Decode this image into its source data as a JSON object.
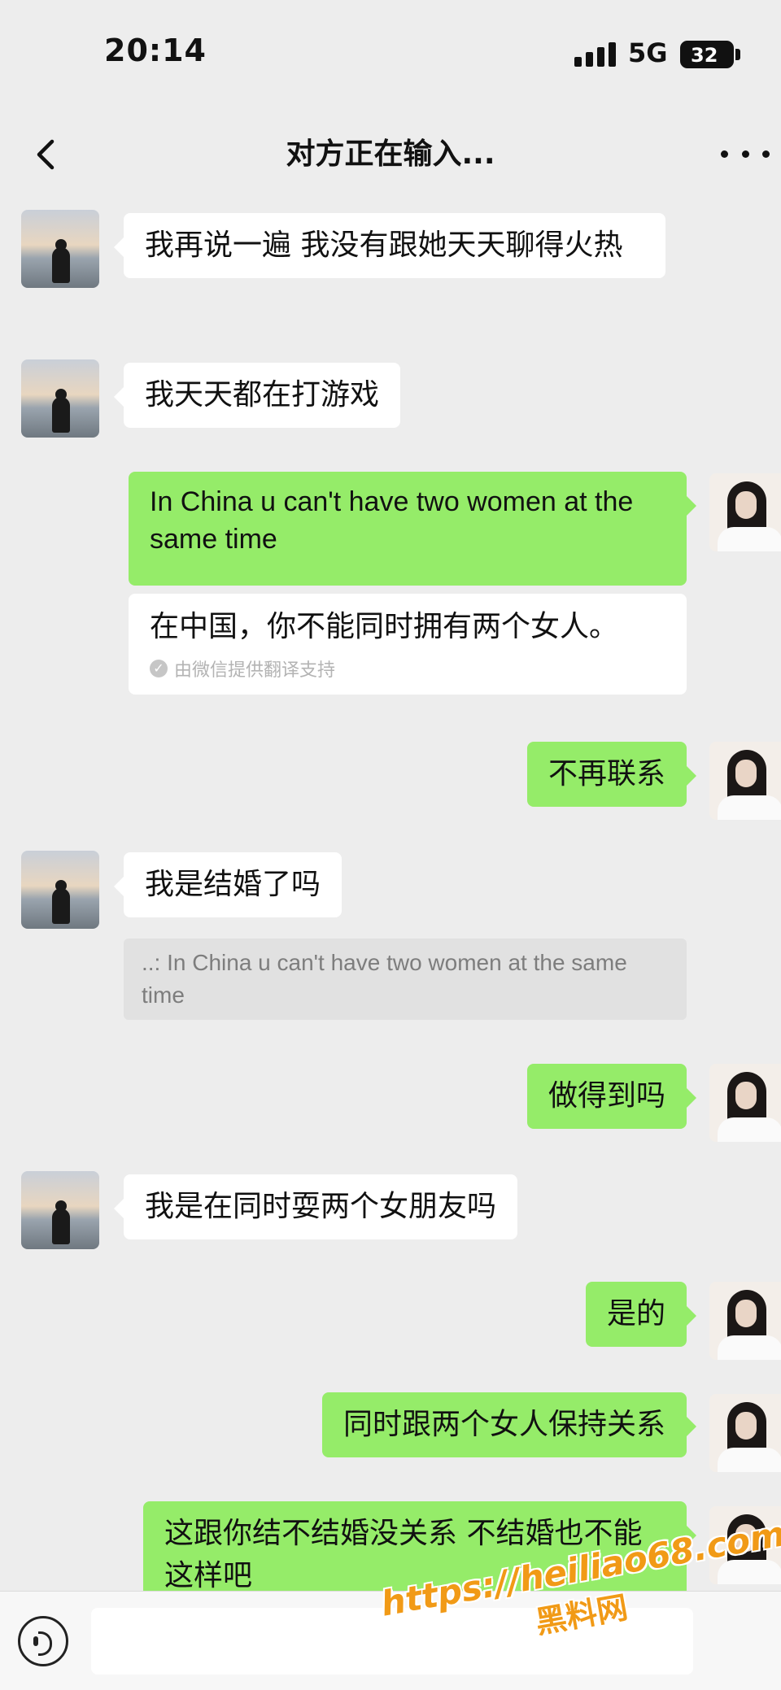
{
  "status_bar": {
    "time": "20:14",
    "network": "5G",
    "battery": "32"
  },
  "header": {
    "title": "对方正在输入..."
  },
  "messages": [
    {
      "side": "left",
      "avatar": "sunset-silhouette-avatar",
      "text": "我再说一遍 我没有跟她天天聊得火热"
    },
    {
      "side": "left",
      "avatar": "sunset-silhouette-avatar",
      "text": "我天天都在打游戏"
    },
    {
      "side": "right",
      "avatar": "woman-avatar",
      "text": "In China u can't have two women at the same time",
      "translation": {
        "text": "在中国，你不能同时拥有两个女人。",
        "note": "由微信提供翻译支持"
      }
    },
    {
      "side": "right",
      "avatar": "woman-avatar",
      "text": "不再联系"
    },
    {
      "side": "left",
      "avatar": "sunset-silhouette-avatar",
      "text": "我是结婚了吗",
      "quote": "..: In China u can't have two women at the same time"
    },
    {
      "side": "right",
      "avatar": "woman-avatar",
      "text": "做得到吗"
    },
    {
      "side": "left",
      "avatar": "sunset-silhouette-avatar",
      "text": "我是在同时耍两个女朋友吗"
    },
    {
      "side": "right",
      "avatar": "woman-avatar",
      "text": "是的"
    },
    {
      "side": "right",
      "avatar": "woman-avatar",
      "text": "同时跟两个女人保持关系"
    },
    {
      "side": "right",
      "avatar": "woman-avatar",
      "text": "这跟你结不结婚没关系 不结婚也不能这样吧"
    }
  ],
  "input": {
    "placeholder": ""
  },
  "watermark": {
    "url": "https://heiliao68.com",
    "name": "黑料网"
  },
  "colors": {
    "background": "#ededed",
    "sent_bubble": "#95ec69",
    "received_bubble": "#ffffff",
    "watermark": "#f19a16"
  }
}
